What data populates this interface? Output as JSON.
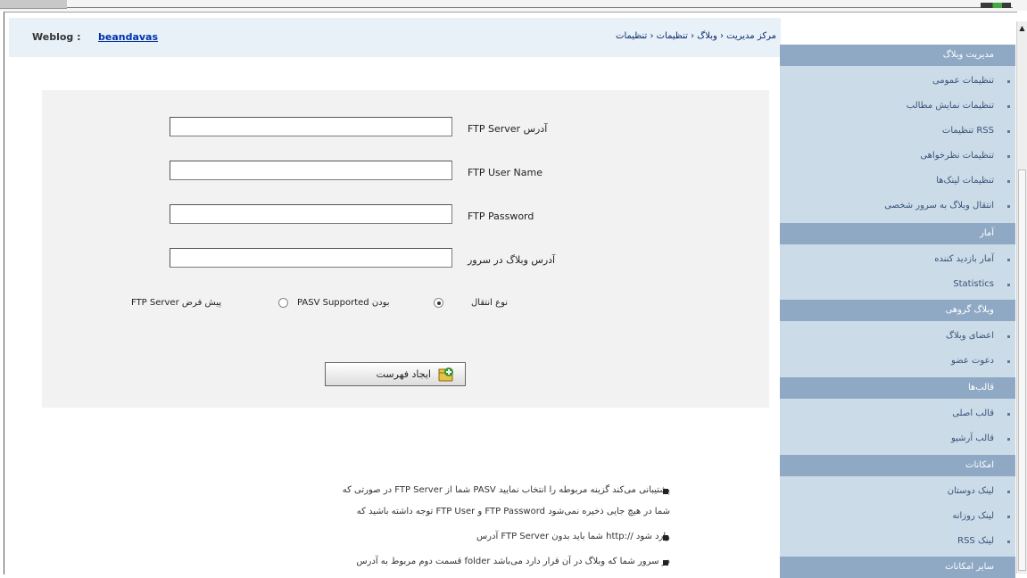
{
  "header": {
    "weblog_label": "Weblog :",
    "weblog_link": "beandavas",
    "breadcrumb": "مرکز مدیریت ‹ وبلاگ ‹ تنظیمات ‹ تنظیمات"
  },
  "form": {
    "fields": [
      {
        "label": "FTP Server آدرس",
        "value": ""
      },
      {
        "label": "FTP User Name",
        "value": ""
      },
      {
        "label": "FTP Password",
        "value": ""
      },
      {
        "label": "آدرس وبلاگ در سرور",
        "value": ""
      }
    ],
    "mode_label": "نوع انتقال",
    "option_supported": "PASV Supported بودن",
    "option_other": "FTP Server پیش فرض",
    "option_supported_selected": true,
    "submit_label": "ایجاد فهرست"
  },
  "notes": [
    "در صورتی که FTP Server شما از PASV پشتیبانی می‌کند گزینه مربوطه را انتخاب نمایید",
    "توجه داشته باشید که FTP User و FTP Password شما در هیچ جایی ذخیره نمی‌شود",
    "آدرس FTP Server شما باید بدون http:// وارد شود",
    "قسمت دوم مربوط به آدرس folder در سرور شما که وبلاگ در آن قرار دارد می‌باشد"
  ],
  "sidebar": {
    "sections": [
      {
        "title": "مدیریت وبلاگ",
        "items": [
          "تنظیمات عمومی",
          "تنظیمات نمایش مطالب",
          "تنظیمات RSS",
          "تنظیمات نظرخواهی",
          "تنظیمات لینک‌ها",
          "انتقال وبلاگ به سرور شخصی"
        ]
      },
      {
        "title": "آمار",
        "items": [
          "آمار بازدید کننده",
          "Statistics"
        ]
      },
      {
        "title": "وبلاگ گروهی",
        "items": [
          "اعضای وبلاگ",
          "دعوت عضو"
        ]
      },
      {
        "title": "قالب‌ها",
        "items": [
          "قالب اصلی",
          "قالب آرشیو"
        ]
      },
      {
        "title": "امکانات",
        "items": [
          "لینک دوستان",
          "لینک روزانه",
          "RSS لینک"
        ]
      },
      {
        "title": "سایر امکانات",
        "items": []
      }
    ]
  },
  "colors": {
    "sidebar_bg": "#ccdbe8",
    "sidebar_header": "#8fa9c4",
    "header_bg": "#e8f1f8",
    "link": "#0033aa"
  }
}
